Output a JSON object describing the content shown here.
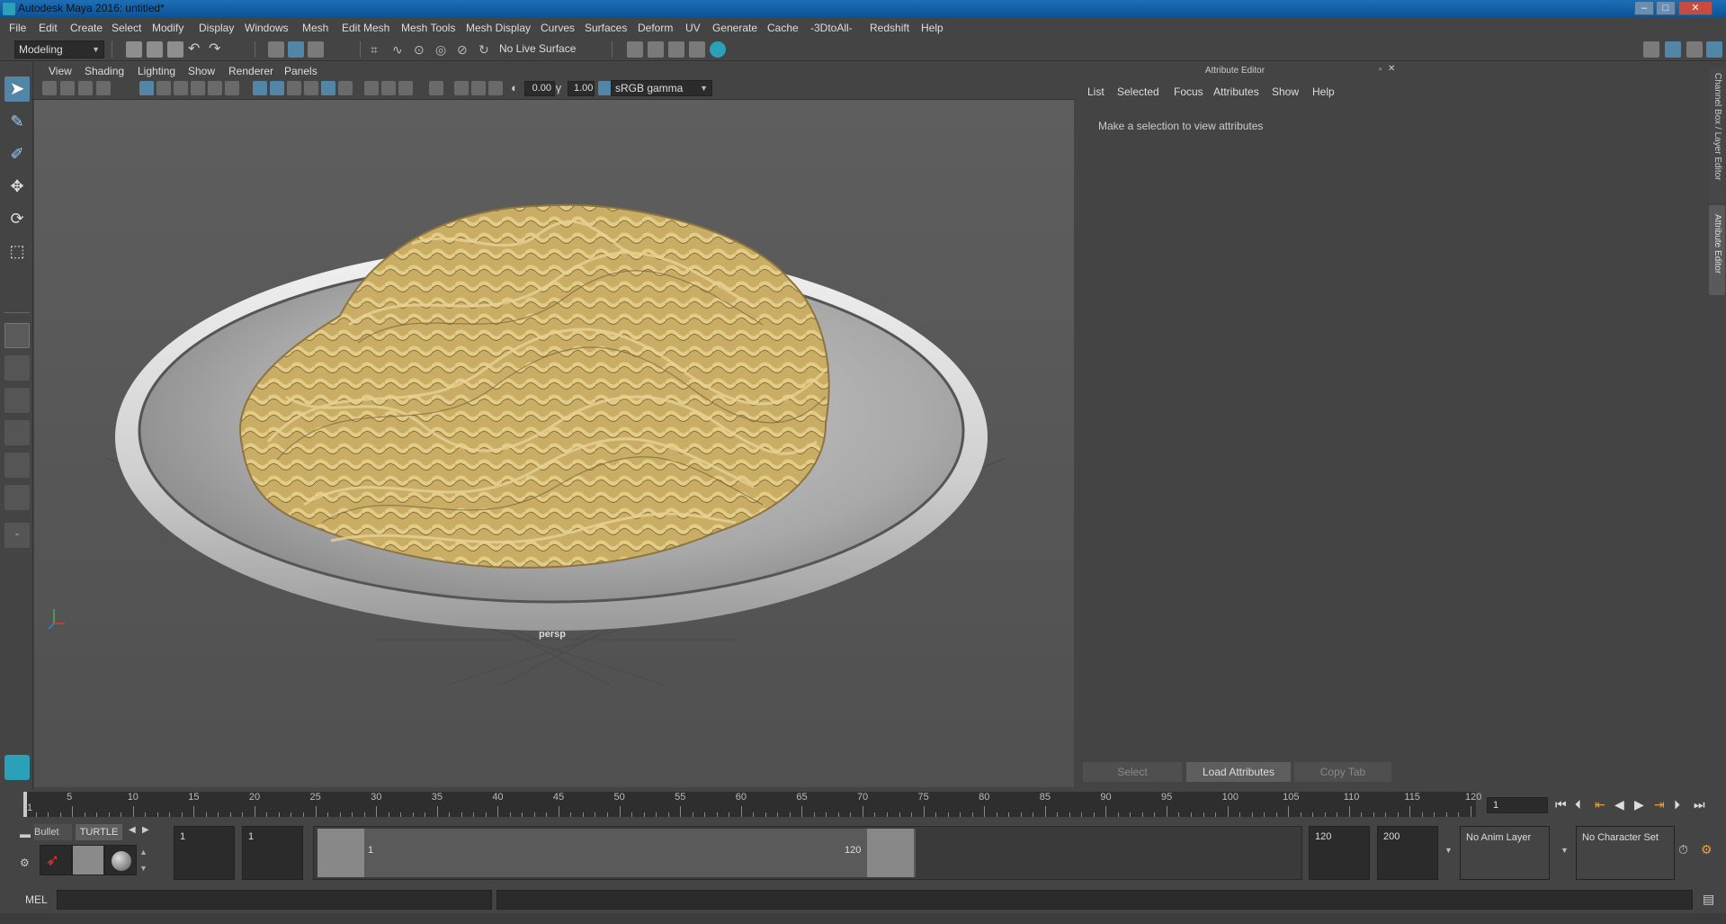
{
  "window": {
    "title": "Autodesk Maya 2016: untitled*"
  },
  "menubar": [
    "File",
    "Edit",
    "Create",
    "Select",
    "Modify",
    "Display",
    "Windows",
    "Mesh",
    "Edit Mesh",
    "Mesh Tools",
    "Mesh Display",
    "Curves",
    "Surfaces",
    "Deform",
    "UV",
    "Generate",
    "Cache",
    "-3DtoAll-",
    "Redshift",
    "Help"
  ],
  "statusline": {
    "menuset": "Modeling",
    "live_surface": "No Live Surface"
  },
  "panel": {
    "menu": [
      "View",
      "Shading",
      "Lighting",
      "Show",
      "Renderer",
      "Panels"
    ],
    "exposure": "0.00",
    "gamma": "1.00",
    "color_space": "sRGB gamma",
    "camera_label": "persp"
  },
  "attribute_editor": {
    "header": "Attribute Editor",
    "menu": [
      "List",
      "Selected",
      "Focus",
      "Attributes",
      "Show",
      "Help"
    ],
    "message": "Make a selection to view attributes",
    "buttons": {
      "select": "Select",
      "load": "Load Attributes",
      "copy": "Copy Tab"
    },
    "side_tabs": [
      "Channel Box / Layer Editor",
      "Attribute Editor"
    ]
  },
  "timeslider": {
    "ticks": [
      1,
      5,
      10,
      15,
      20,
      25,
      30,
      35,
      40,
      45,
      50,
      55,
      60,
      65,
      70,
      75,
      80,
      85,
      90,
      95,
      100,
      105,
      110,
      115,
      120
    ],
    "current_frame": "1"
  },
  "shelf": {
    "tabs": [
      "Bullet",
      "TURTLE"
    ]
  },
  "rangeslider": {
    "start": "1",
    "playback_start": "1",
    "range_start_label": "1",
    "range_end_label": "120",
    "playback_end": "120",
    "end": "200",
    "anim_layer": "No Anim Layer",
    "character_set": "No Character Set"
  },
  "commandline": {
    "label": "MEL"
  },
  "colors": {
    "accent": "#5285a6",
    "viewport_bg": "#5a5a5a",
    "pasta": "#d9c17a",
    "plate": "#c8c8c8"
  }
}
